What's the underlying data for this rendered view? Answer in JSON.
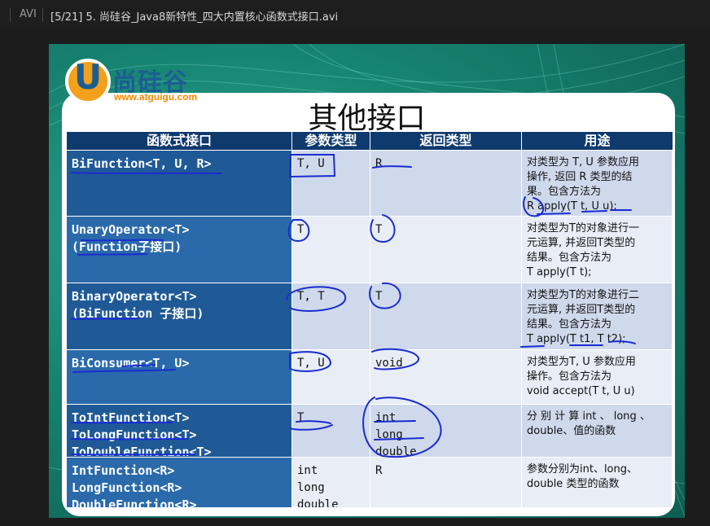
{
  "titlebar": {
    "format": "AVI",
    "title": "[5/21] 5. 尚硅谷_Java8新特性_四大内置核心函数式接口.avi"
  },
  "logo": {
    "letter": "U",
    "brand": "尚硅谷",
    "url": "www.atguigu.com"
  },
  "slide": {
    "heading": "其他接口",
    "columns": [
      "函数式接口",
      "参数类型",
      "返回类型",
      "用途"
    ],
    "rows": [
      {
        "iface": [
          "BiFunction<T, U, R>"
        ],
        "params": [
          "T, U"
        ],
        "returns": [
          "R"
        ],
        "usage": [
          "对类型为 T, U 参数应用",
          "操作, 返回 R 类型的结",
          "果。包含方法为",
          "R apply(T t, U u);"
        ]
      },
      {
        "iface": [
          "UnaryOperator<T>",
          "(Function子接口)"
        ],
        "params": [
          "T"
        ],
        "returns": [
          "T"
        ],
        "usage": [
          "对类型为T的对象进行一",
          "元运算, 并返回T类型的",
          "结果。包含方法为",
          "T apply(T t);"
        ]
      },
      {
        "iface": [
          "BinaryOperator<T>",
          "(BiFunction 子接口)"
        ],
        "params": [
          "T, T"
        ],
        "returns": [
          "T"
        ],
        "usage": [
          "对类型为T的对象进行二",
          "元运算, 并返回T类型的",
          "结果。包含方法为",
          "T apply(T t1, T t2);"
        ]
      },
      {
        "iface": [
          "BiConsumer<T, U>"
        ],
        "params": [
          "T, U"
        ],
        "returns": [
          "void"
        ],
        "usage": [
          "对类型为T, U 参数应用",
          "操作。包含方法为",
          "void accept(T t, U u)"
        ]
      },
      {
        "iface": [
          "ToIntFunction<T>",
          "ToLongFunction<T>",
          "ToDoubleFunction<T>"
        ],
        "params": [
          "T"
        ],
        "returns": [
          "int",
          "long",
          "double"
        ],
        "usage": [
          "分 别 计 算 int 、 long 、",
          "double、值的函数"
        ]
      },
      {
        "iface": [
          "IntFunction<R>",
          "LongFunction<R>",
          "DoubleFunction<R>"
        ],
        "params": [
          "int",
          "long",
          "double"
        ],
        "returns": [
          "R"
        ],
        "usage": [
          "参数分别为int、long、",
          "double 类型的函数"
        ]
      }
    ]
  }
}
